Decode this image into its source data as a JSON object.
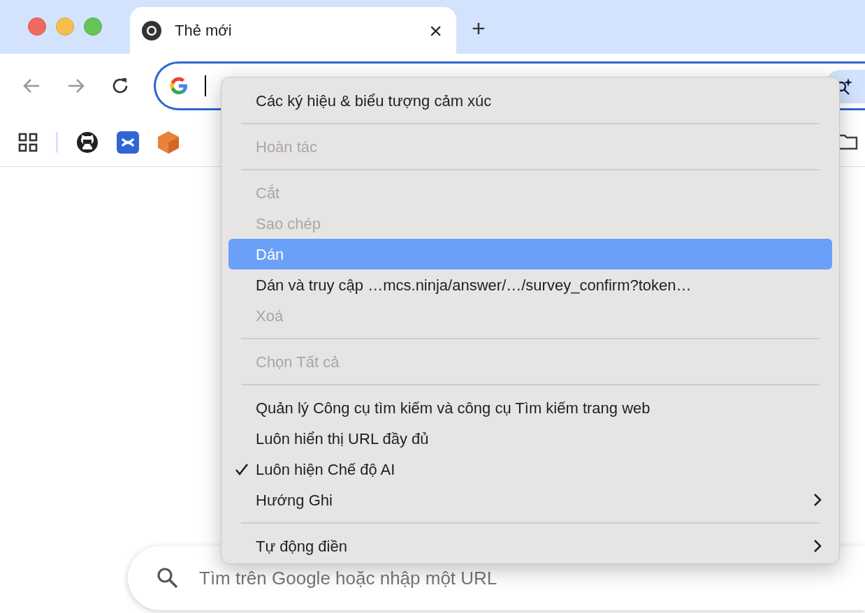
{
  "tab": {
    "title": "Thẻ mới",
    "close": "×",
    "new_tab": "+"
  },
  "menu": {
    "items": [
      {
        "kind": "item",
        "label": "Các ký hiệu & biểu tượng cảm xúc",
        "disabled": false,
        "selected": false,
        "checked": false,
        "submenu": false
      },
      {
        "kind": "separator"
      },
      {
        "kind": "item",
        "label": "Hoàn tác",
        "disabled": true,
        "selected": false,
        "checked": false,
        "submenu": false
      },
      {
        "kind": "separator"
      },
      {
        "kind": "item",
        "label": "Cắt",
        "disabled": true,
        "selected": false,
        "checked": false,
        "submenu": false
      },
      {
        "kind": "item",
        "label": "Sao chép",
        "disabled": true,
        "selected": false,
        "checked": false,
        "submenu": false
      },
      {
        "kind": "item",
        "label": "Dán",
        "disabled": false,
        "selected": true,
        "checked": false,
        "submenu": false
      },
      {
        "kind": "item",
        "label": "Dán và truy cập …mcs.ninja/answer/…/survey_confirm?token…",
        "disabled": false,
        "selected": false,
        "checked": false,
        "submenu": false
      },
      {
        "kind": "item",
        "label": "Xoá",
        "disabled": true,
        "selected": false,
        "checked": false,
        "submenu": false
      },
      {
        "kind": "separator"
      },
      {
        "kind": "item",
        "label": "Chọn Tất cả",
        "disabled": true,
        "selected": false,
        "checked": false,
        "submenu": false
      },
      {
        "kind": "separator"
      },
      {
        "kind": "item",
        "label": "Quản lý Công cụ tìm kiếm và công cụ Tìm kiếm trang web",
        "disabled": false,
        "selected": false,
        "checked": false,
        "submenu": false
      },
      {
        "kind": "item",
        "label": "Luôn hiển thị URL đầy đủ",
        "disabled": false,
        "selected": false,
        "checked": false,
        "submenu": false
      },
      {
        "kind": "item",
        "label": "Luôn hiện Chế độ AI",
        "disabled": false,
        "selected": false,
        "checked": true,
        "submenu": false
      },
      {
        "kind": "item",
        "label": "Hướng Ghi",
        "disabled": false,
        "selected": false,
        "checked": false,
        "submenu": true
      },
      {
        "kind": "separator"
      },
      {
        "kind": "item",
        "label": "Tự động điền",
        "disabled": false,
        "selected": false,
        "checked": false,
        "submenu": true
      }
    ]
  },
  "search": {
    "placeholder": "Tìm trên Google hoặc nhập một URL"
  }
}
